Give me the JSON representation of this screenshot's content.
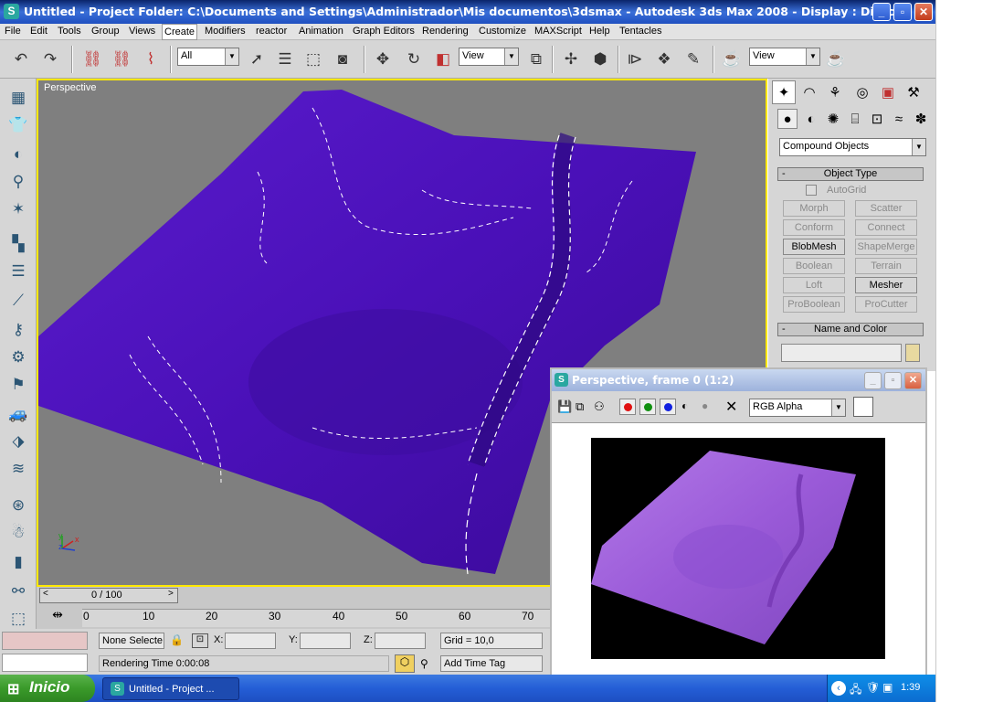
{
  "window": {
    "title": "Untitled      - Project Folder: C:\\Documents and Settings\\Administrador\\Mis documentos\\3dsmax      - Autodesk 3ds Max 2008      - Display : Direct...",
    "buttons": {
      "minimize": "_",
      "maximize": "▫",
      "close": "✕"
    }
  },
  "menu": {
    "items": [
      "File",
      "Edit",
      "Tools",
      "Group",
      "Views",
      "Create",
      "Modifiers",
      "reactor",
      "Animation",
      "Graph Editors",
      "Rendering",
      "Customize",
      "MAXScript",
      "Help",
      "Tentacles"
    ],
    "active": "Create"
  },
  "toolbar": {
    "selection_filter": "All",
    "ref_coord": "View",
    "ref_coord_2": "View"
  },
  "viewport": {
    "label": "Perspective",
    "surface_color": "#4a10b8",
    "bg_color": "#7f7f7f",
    "axis": {
      "x": "x",
      "y": "y",
      "z": "z"
    }
  },
  "command_panel": {
    "category": "Compound Objects",
    "object_type": {
      "title": "Object Type",
      "autogrid_label": "AutoGrid",
      "buttons": [
        {
          "label": "Morph",
          "enabled": false
        },
        {
          "label": "Scatter",
          "enabled": false
        },
        {
          "label": "Conform",
          "enabled": false
        },
        {
          "label": "Connect",
          "enabled": false
        },
        {
          "label": "BlobMesh",
          "enabled": true
        },
        {
          "label": "ShapeMerge",
          "enabled": false
        },
        {
          "label": "Boolean",
          "enabled": false
        },
        {
          "label": "Terrain",
          "enabled": false
        },
        {
          "label": "Loft",
          "enabled": false
        },
        {
          "label": "Mesher",
          "enabled": true
        },
        {
          "label": "ProBoolean",
          "enabled": false
        },
        {
          "label": "ProCutter",
          "enabled": false
        }
      ]
    },
    "name_and_color": {
      "title": "Name and Color",
      "name_value": "",
      "swatch": "#e8d9a0"
    }
  },
  "timeline": {
    "slider_label": "0 / 100",
    "ticks": [
      "0",
      "10",
      "20",
      "30",
      "40",
      "50",
      "60",
      "70"
    ]
  },
  "status": {
    "selection": "None Selecte",
    "x_label": "X:",
    "y_label": "Y:",
    "z_label": "Z:",
    "x_value": "",
    "y_value": "",
    "z_value": "",
    "grid": "Grid = 10,0",
    "render_time": "Rendering Time  0:00:08",
    "add_time_tag": "Add Time Tag"
  },
  "frame_window": {
    "title": "Perspective, frame 0 (1:2)",
    "channel": "RGB Alpha",
    "render_color": "#9a5ad8"
  },
  "taskbar": {
    "start_label": "Inicio",
    "task_label": "Untitled      - Project ...",
    "clock": "1:39"
  }
}
